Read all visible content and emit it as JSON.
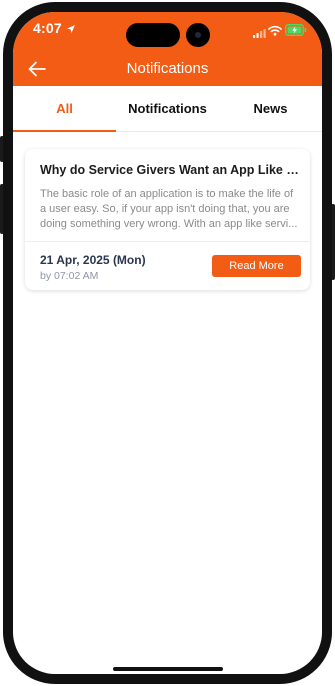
{
  "status_bar": {
    "time": "4:07",
    "icons": [
      "location-arrow-icon",
      "signal-icon",
      "wifi-icon",
      "battery-charging-icon"
    ],
    "battery_color": "#4cd964"
  },
  "header": {
    "title": "Notifications",
    "back_icon": "arrow-left-icon",
    "background_color": "#f25c15"
  },
  "tabs": [
    {
      "label": "All",
      "active": true
    },
    {
      "label": "Notifications",
      "active": false
    },
    {
      "label": "News",
      "active": false
    }
  ],
  "notifications": [
    {
      "title": "Why do Service Givers Want an App Like th...",
      "body": "The basic role of an application is to make the life of a user easy. So, if your app isn't doing that, you are doing something very wrong. With an app like servi...",
      "date": "21 Apr, 2025 (Mon)",
      "time": "by 07:02 AM",
      "action_label": "Read More"
    }
  ],
  "colors": {
    "accent": "#f25c15",
    "date_text": "#2a3550",
    "muted_text": "#8a8a8a"
  }
}
